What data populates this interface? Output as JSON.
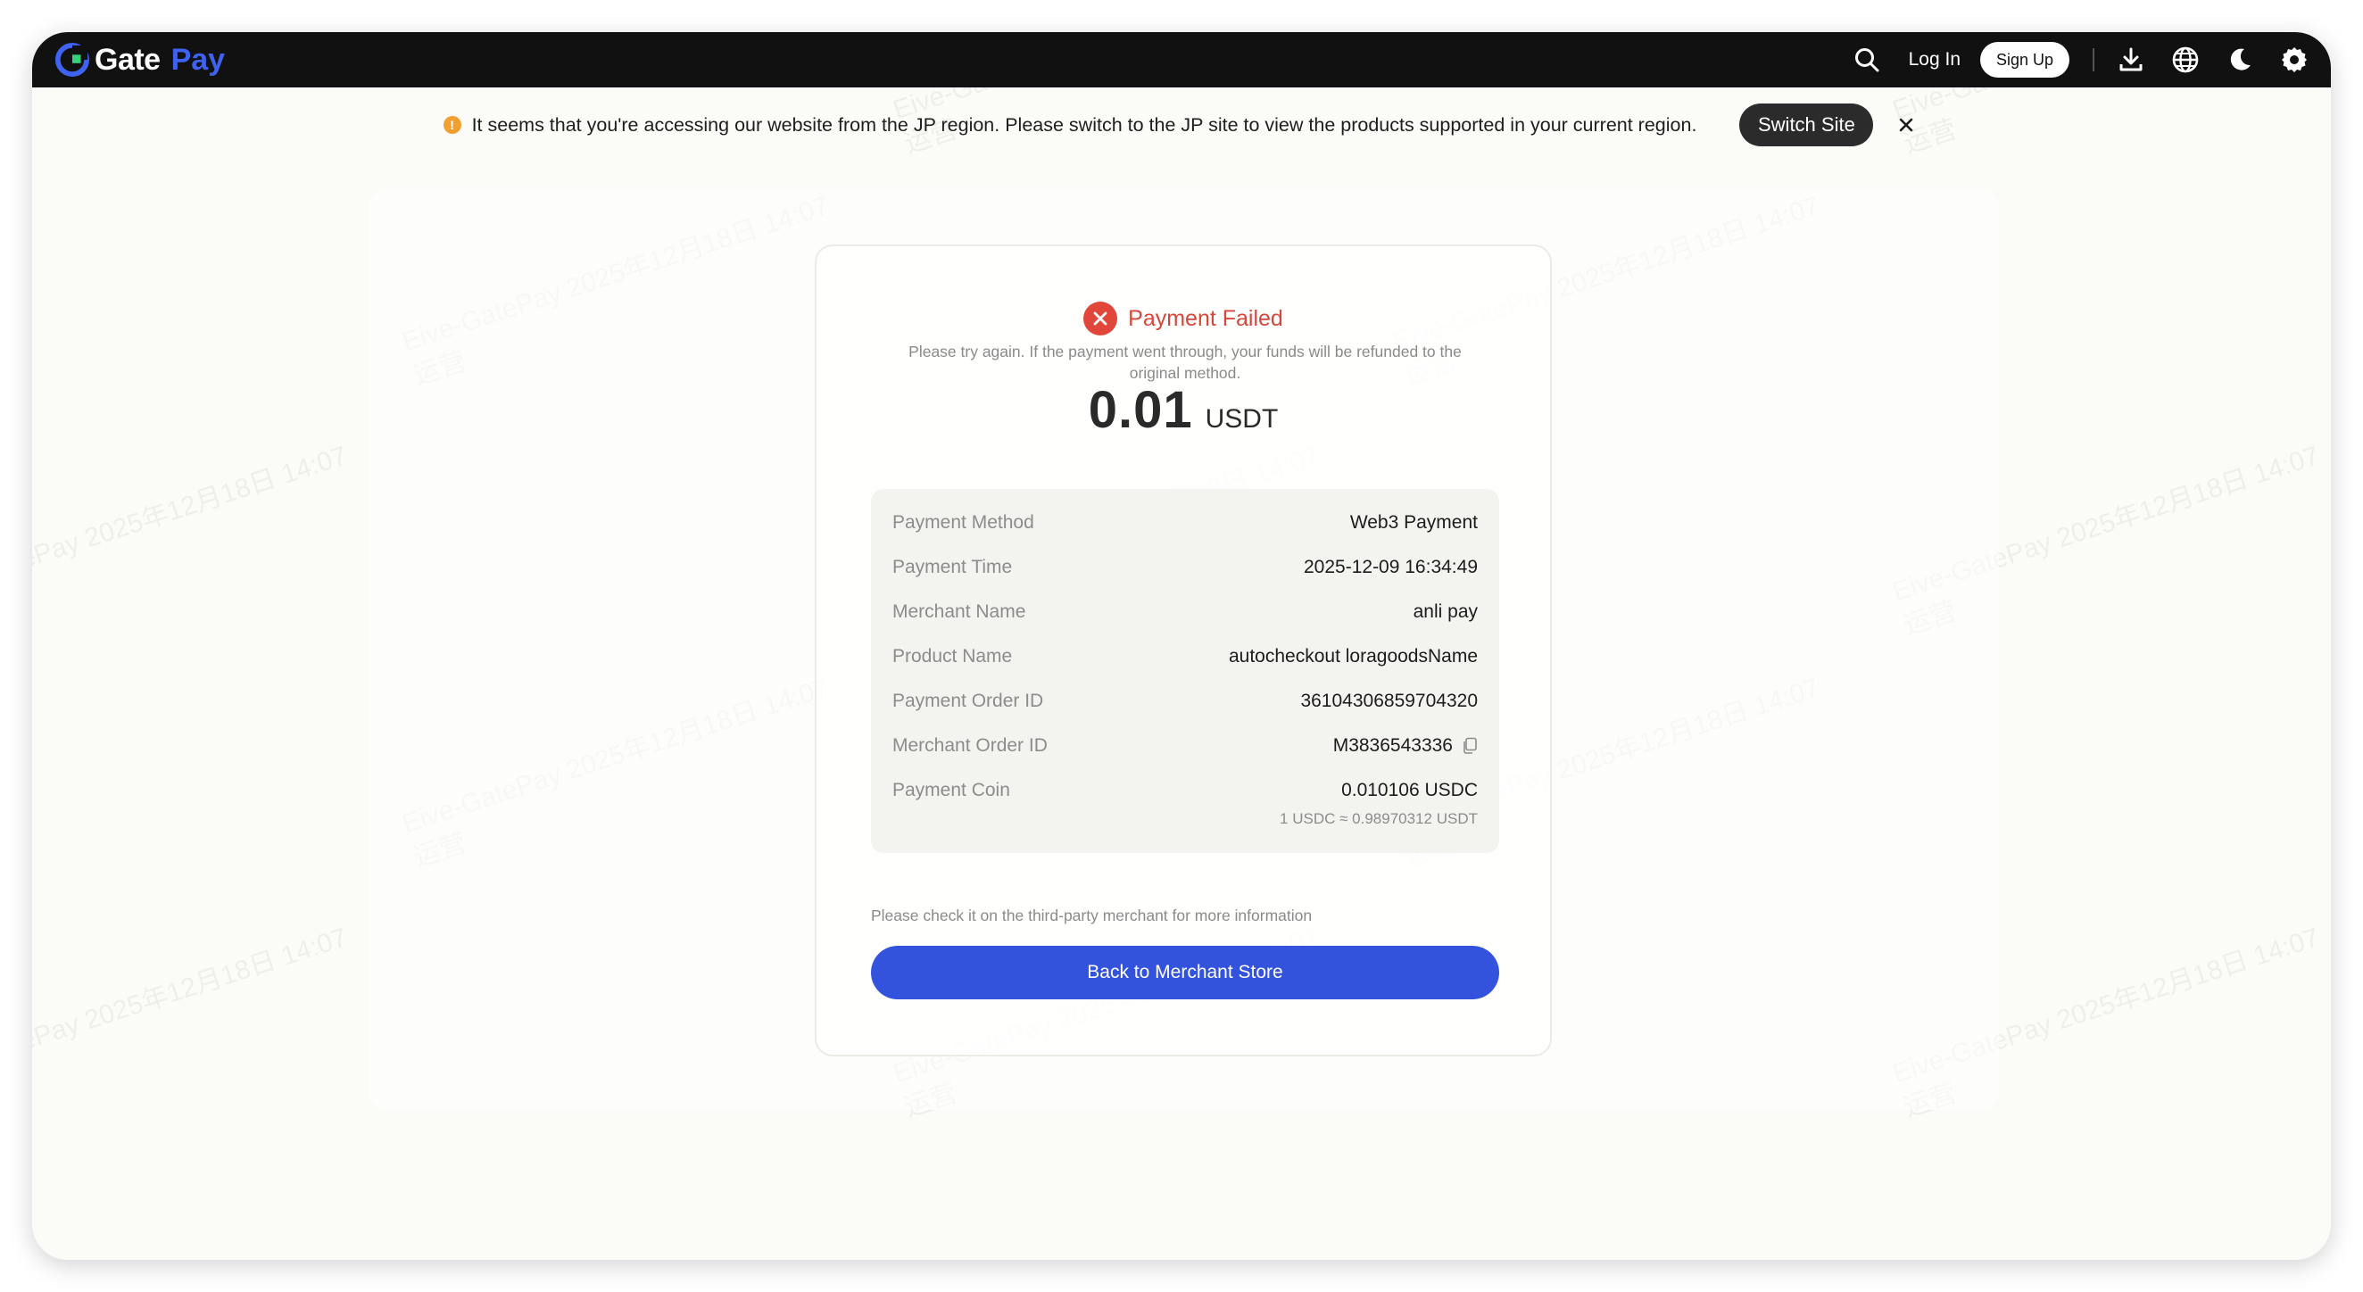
{
  "colors": {
    "topbar_bg": "#111111",
    "brand_blue": "#3f63f0",
    "primary_button": "#3453dc",
    "error_red": "#e0463a",
    "warning_orange": "#f0a030"
  },
  "header": {
    "logo_text": "Gate",
    "logo_accent": "Pay",
    "icons": [
      "search-icon",
      "download-icon",
      "globe-icon",
      "moon-icon",
      "gear-icon"
    ],
    "login_label": "Log In",
    "signup_label": "Sign Up"
  },
  "notice": {
    "icon": "!",
    "text": "It seems that you're accessing our website from the JP region. Please switch to the JP site to view the products supported in your current region.",
    "switch_label": "Switch Site"
  },
  "result": {
    "title": "Payment Failed",
    "subtitle": "Please try again. If the payment went through, your funds will be refunded to the original method.",
    "amount": "0.01",
    "currency": "USDT"
  },
  "details": {
    "rows": [
      {
        "label": "Payment Method",
        "value": "Web3 Payment"
      },
      {
        "label": "Payment Time",
        "value": "2025-12-09 16:34:49"
      },
      {
        "label": "Merchant Name",
        "value": "anli pay"
      },
      {
        "label": "Product Name",
        "value": "autocheckout loragoodsName"
      },
      {
        "label": "Payment Order ID",
        "value": "361043068597043​20"
      },
      {
        "label": "Merchant Order ID",
        "value": "M3836543336"
      },
      {
        "label": "Payment Coin",
        "value": "0.010106 USDC"
      }
    ],
    "rate": "1 USDC ≈ 0.98970312 USDT"
  },
  "footer": {
    "hint": "Please check it on the third-party merchant for more information",
    "back_label": "Back to Merchant Store"
  },
  "watermark": {
    "line1": "Eive-GatePay 2025年12月18日 14:07",
    "line2": "运营"
  }
}
